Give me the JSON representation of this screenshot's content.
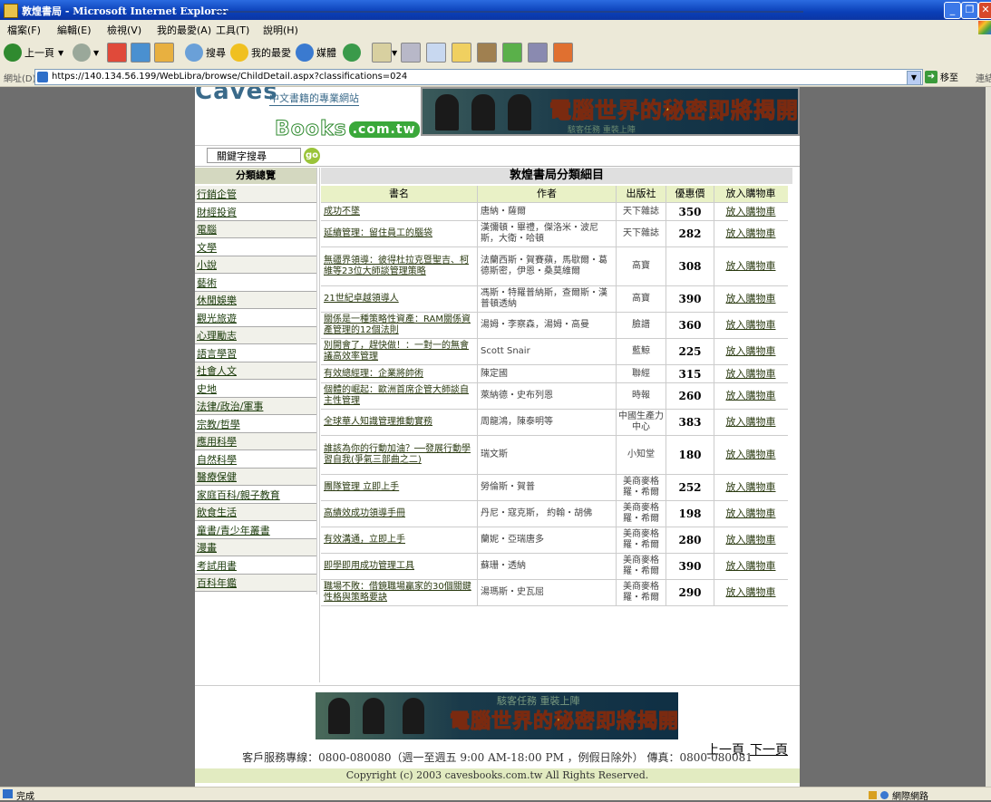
{
  "window": {
    "title": "敦煌書局 - Microsoft Internet Explorer"
  },
  "menu": [
    "檔案(F)",
    "編輯(E)",
    "檢視(V)",
    "我的最愛(A)",
    "工具(T)",
    "說明(H)"
  ],
  "toolbar": {
    "back": "上一頁",
    "search": "搜尋",
    "favorites": "我的最愛",
    "media": "媒體"
  },
  "address": {
    "label": "網址(D)",
    "url": "https://140.134.56.199/WebLibra/browse/ChildDetail.aspx?classifications=024",
    "go": "移至",
    "links": "連結"
  },
  "logo": {
    "top": "Caves",
    "top_sub": "中文書籍的專業網站",
    "bottom": "Books",
    "domain": ".com.tw"
  },
  "ad": {
    "text": "電腦世界的秘密即將揭開",
    "sub": "駭客任務 重裝上陣"
  },
  "search": {
    "value": "關鍵字搜尋",
    "go": "go"
  },
  "sidebar": {
    "title": "分類總覽",
    "items": [
      "行銷企管",
      "財經投資",
      "電腦",
      "文學",
      "小說",
      "藝術",
      "休閒娛樂",
      "觀光旅遊",
      "心理勵志",
      "語言學習",
      "社會人文",
      "史地",
      "法律/政治/軍事",
      "宗教/哲學",
      "應用科學",
      "自然科學",
      "醫療保健",
      "家庭百科/親子教育",
      "飲食生活",
      "童書/青少年叢書",
      "漫畫",
      "考試用書",
      "百科年鑑"
    ]
  },
  "main": {
    "title": "敦煌書局分類細目",
    "headers": [
      "書名",
      "作者",
      "出版社",
      "優惠價",
      "放入購物車"
    ],
    "rows": [
      {
        "title": "成功不墜",
        "author": "唐納・薩爾",
        "publisher": "天下雜誌",
        "price": "350",
        "cart": "放入購物車"
      },
      {
        "title": "延續管理：留住員工的腦袋",
        "author": "漢彌頓・畢禮，傑洛米・波尼斯，大衛・哈頓",
        "publisher": "天下雜誌",
        "price": "282",
        "cart": "放入購物車"
      },
      {
        "title": "無疆界領導：彼得杜拉克暨聖吉、柯維等23位大師談管理策略",
        "author": "法蘭西斯・賀賽蘋，馬歇爾・葛德斯密，伊恩・桑莫維爾",
        "publisher": "高寶",
        "price": "308",
        "cart": "放入購物車"
      },
      {
        "title": "21世紀卓越領導人",
        "author": "馮斯・特羅普納斯，查爾斯・漢普頓透納",
        "publisher": "高寶",
        "price": "390",
        "cart": "放入購物車"
      },
      {
        "title": "關係是一種策略性資產：RAM關係資產管理的12個法則",
        "author": "湯姆・李察森，湯姆・高曼",
        "publisher": "臉譜",
        "price": "360",
        "cart": "放入購物車"
      },
      {
        "title": "別開會了，趕快做！：一對一的無會議高效率管理",
        "author": "Scott Snair",
        "publisher": "藍鯨",
        "price": "225",
        "cart": "放入購物車"
      },
      {
        "title": "有效總經理：企業將帥術",
        "author": "陳定國",
        "publisher": "聯經",
        "price": "315",
        "cart": "放入購物車"
      },
      {
        "title": "個體的崛起：歐洲首席企管大師談自主性管理",
        "author": "萊納德・史布列恩",
        "publisher": "時報",
        "price": "260",
        "cart": "放入購物車"
      },
      {
        "title": "全球華人知識管理推動實務",
        "author": "周龍鴻，陳泰明等",
        "publisher": "中國生產力中心",
        "price": "383",
        "cart": "放入購物車"
      },
      {
        "title": "誰該為你的行動加油？──發展行動學習自我(爭氣三部曲之二)",
        "author": "瑞文斯",
        "publisher": "小知堂",
        "price": "180",
        "cart": "放入購物車"
      },
      {
        "title": "團隊管理 立即上手",
        "author": "勞倫斯・賀普",
        "publisher": "美商麥格羅・希爾",
        "price": "252",
        "cart": "放入購物車"
      },
      {
        "title": "高績效成功領導手冊",
        "author": "丹尼・寇克斯， 約翰・胡佛",
        "publisher": "美商麥格羅・希爾",
        "price": "198",
        "cart": "放入購物車"
      },
      {
        "title": "有效溝通，立即上手",
        "author": "蘭妮・亞瑞唐多",
        "publisher": "美商麥格羅・希爾",
        "price": "280",
        "cart": "放入購物車"
      },
      {
        "title": "即學即用成功管理工具",
        "author": "蘇珊・透納",
        "publisher": "美商麥格羅・希爾",
        "price": "390",
        "cart": "放入購物車"
      },
      {
        "title": "職場不敗：借鏡職場贏家的30個關鍵性格與策略要訣",
        "author": "湯瑪斯・史瓦屈",
        "publisher": "美商麥格羅・希爾",
        "price": "290",
        "cart": "放入購物車"
      }
    ],
    "prev": "上一頁",
    "next": "下一頁"
  },
  "footer": {
    "service": "客戶服務專線：0800-080080（週一至週五 9:00 AM-18:00 PM ，例假日除外） 傳真：0800-080081",
    "copyright": "Copyright (c) 2003 cavesbooks.com.tw All Rights Reserved."
  },
  "status": {
    "text": "完成",
    "zone": "網際網路"
  }
}
